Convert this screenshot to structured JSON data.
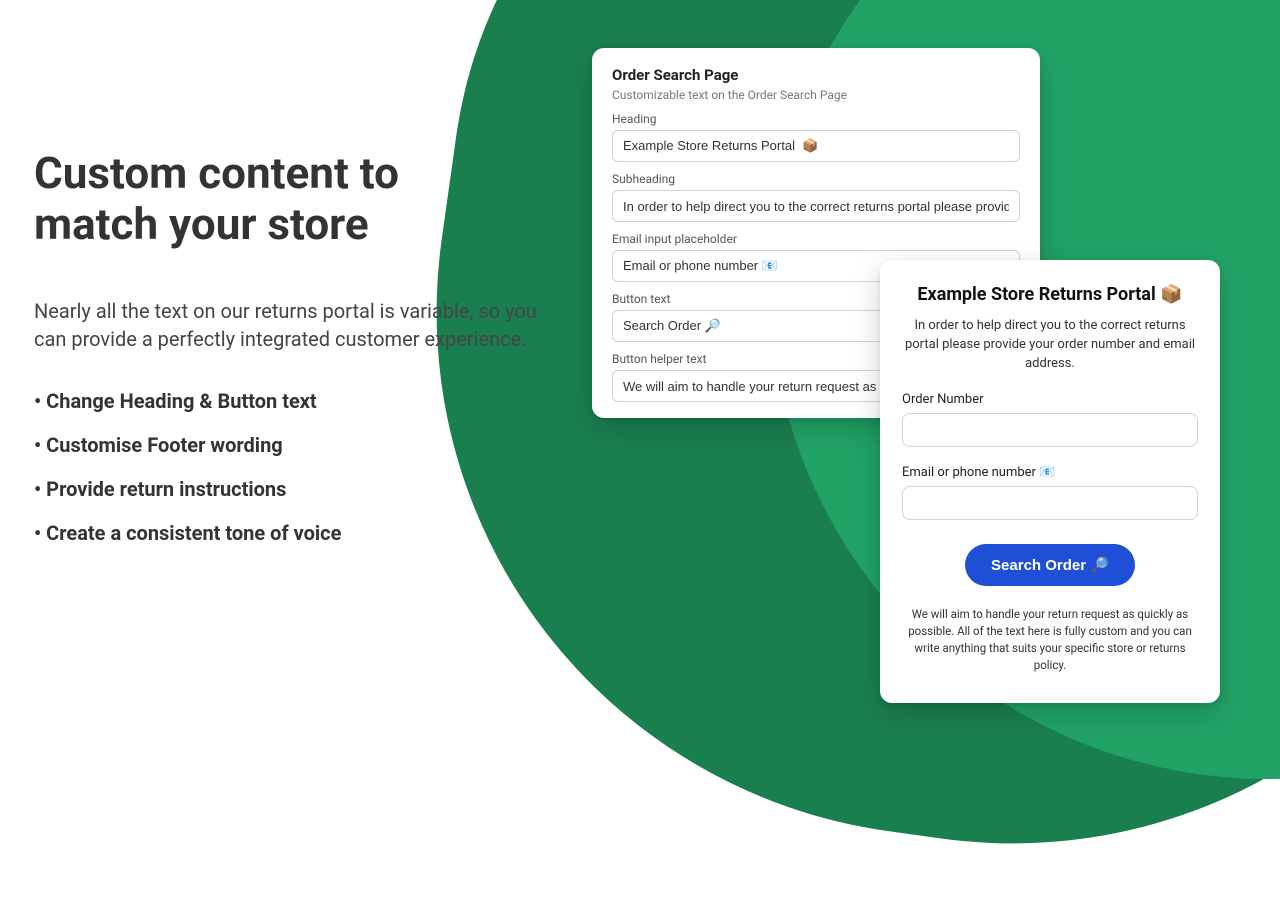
{
  "promo": {
    "heading_l1": "Custom content to",
    "heading_l2": "match your store",
    "sub": "Nearly all the text on our returns portal is variable, so you can provide a perfectly integrated customer experience.",
    "bullets": [
      "Change Heading & Button text",
      "Customise Footer wording",
      "Provide return instructions",
      "Create a consistent tone of voice"
    ]
  },
  "settings": {
    "title": "Order Search Page",
    "desc": "Customizable text on the Order Search Page",
    "fields": {
      "heading": {
        "label": "Heading",
        "value": "Example Store Returns Portal  📦"
      },
      "subheading": {
        "label": "Subheading",
        "value": "In order to help direct you to the correct returns portal please provide your order n"
      },
      "email_placeholder": {
        "label": "Email input placeholder",
        "value": "Email or phone number 📧"
      },
      "button_text": {
        "label": "Button text",
        "value": "Search Order 🔎"
      },
      "button_helper": {
        "label": "Button helper text",
        "value": "We will aim to handle your return request as quickl"
      }
    }
  },
  "preview": {
    "heading": "Example Store Returns Portal 📦",
    "intro": "In order to help direct you to the correct returns portal please provide your order number and email address.",
    "order_label": "Order Number",
    "email_label": "Email or phone number 📧",
    "button": "Search Order 🔎",
    "helper": "We will aim to handle your return request as quickly as possible. All of the text here is fully custom and you can write anything that suits your specific store or returns policy."
  },
  "colors": {
    "brand_green_dark": "#1a7f4f",
    "brand_green_light": "#21a366",
    "button_blue": "#1f4fd6"
  }
}
